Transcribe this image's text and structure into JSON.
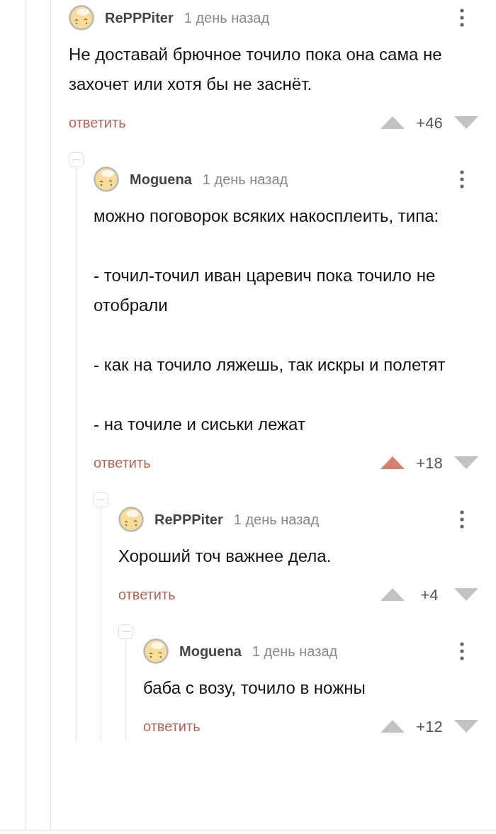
{
  "comments": [
    {
      "author": "RePPPiter",
      "time": "1 день назад",
      "body": "Не доставай брючное точило пока она сама не захочет или хотя бы не заснёт.",
      "reply": "ответить",
      "rating": "+46",
      "upvoted": false,
      "children": [
        {
          "author": "Moguena",
          "time": "1 день назад",
          "body": "можно поговорок всяких накосплеить, типа:\n\n- точил-точил иван царевич пока точило не отобрали\n\n- как на точило ляжешь, так искры и полетят\n\n- на точиле и сиськи лежат",
          "reply": "ответить",
          "rating": "+18",
          "upvoted": true,
          "children": [
            {
              "author": "RePPPiter",
              "time": "1 день назад",
              "body": "Хороший точ важнее дела.",
              "reply": "ответить",
              "rating": "+4",
              "upvoted": false,
              "children": [
                {
                  "author": "Moguena",
                  "time": "1 день назад",
                  "body": "баба с возу, точило в ножны",
                  "reply": "ответить",
                  "rating": "+12",
                  "upvoted": false
                }
              ]
            }
          ]
        }
      ]
    }
  ]
}
